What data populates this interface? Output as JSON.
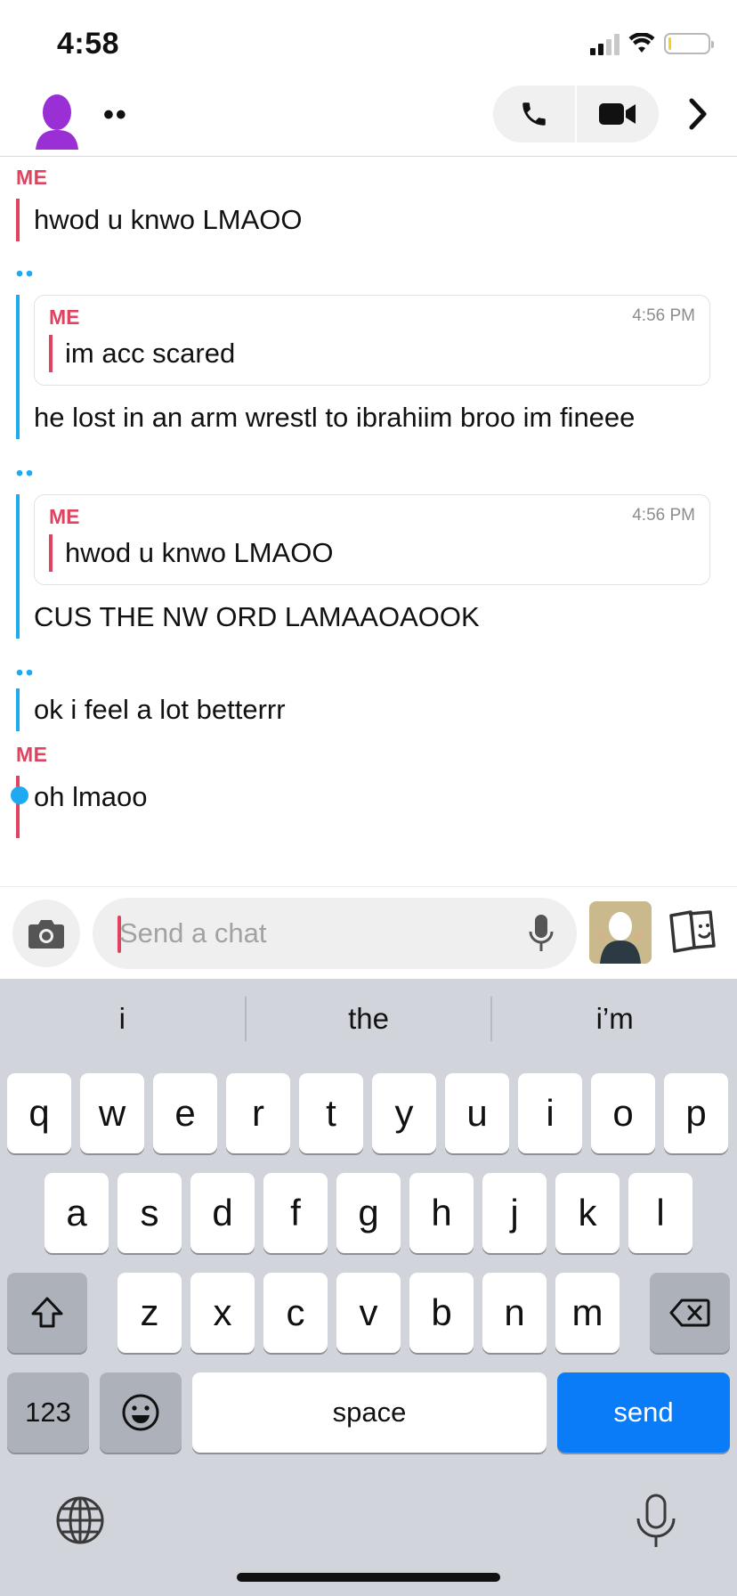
{
  "status_bar": {
    "time": "4:58",
    "battery_level": 0.08,
    "signal_bars": 2
  },
  "header": {
    "friend_name": "••"
  },
  "messages": [
    {
      "sender": "ME",
      "text": "hwod u knwo LMAOO"
    },
    {
      "sender": "••",
      "quote": {
        "sender": "ME",
        "time": "4:56 PM",
        "text": "im acc scared"
      },
      "text": "he lost in an arm wrestl to ibrahiim broo im fineee"
    },
    {
      "sender": "••",
      "quote": {
        "sender": "ME",
        "time": "4:56 PM",
        "text": "hwod u knwo LMAOO"
      },
      "text": "CUS THE NW ORD LAMAAOAOOK"
    },
    {
      "sender": "••",
      "text": "ok i feel a lot betterrr"
    },
    {
      "sender": "ME",
      "text": "oh lmaoo"
    }
  ],
  "input": {
    "placeholder": "Send a chat",
    "value": ""
  },
  "keyboard": {
    "suggestions": [
      "i",
      "the",
      "i’m"
    ],
    "row1": [
      "q",
      "w",
      "e",
      "r",
      "t",
      "y",
      "u",
      "i",
      "o",
      "p"
    ],
    "row2": [
      "a",
      "s",
      "d",
      "f",
      "g",
      "h",
      "j",
      "k",
      "l"
    ],
    "row3": [
      "z",
      "x",
      "c",
      "v",
      "b",
      "n",
      "m"
    ],
    "numbers_label": "123",
    "space_label": "space",
    "send_label": "send"
  },
  "colors": {
    "me": "#e0435f",
    "friend": "#1eaaf1",
    "send_key": "#0b7cf7",
    "avatar": "#9a2fd6",
    "battery": "#f2d21c"
  },
  "icons": [
    "phone-icon",
    "video-camera-icon",
    "chevron-right-icon",
    "camera-icon",
    "microphone-icon",
    "sticker-icon",
    "shift-icon",
    "backspace-icon",
    "emoji-icon",
    "globe-icon"
  ]
}
